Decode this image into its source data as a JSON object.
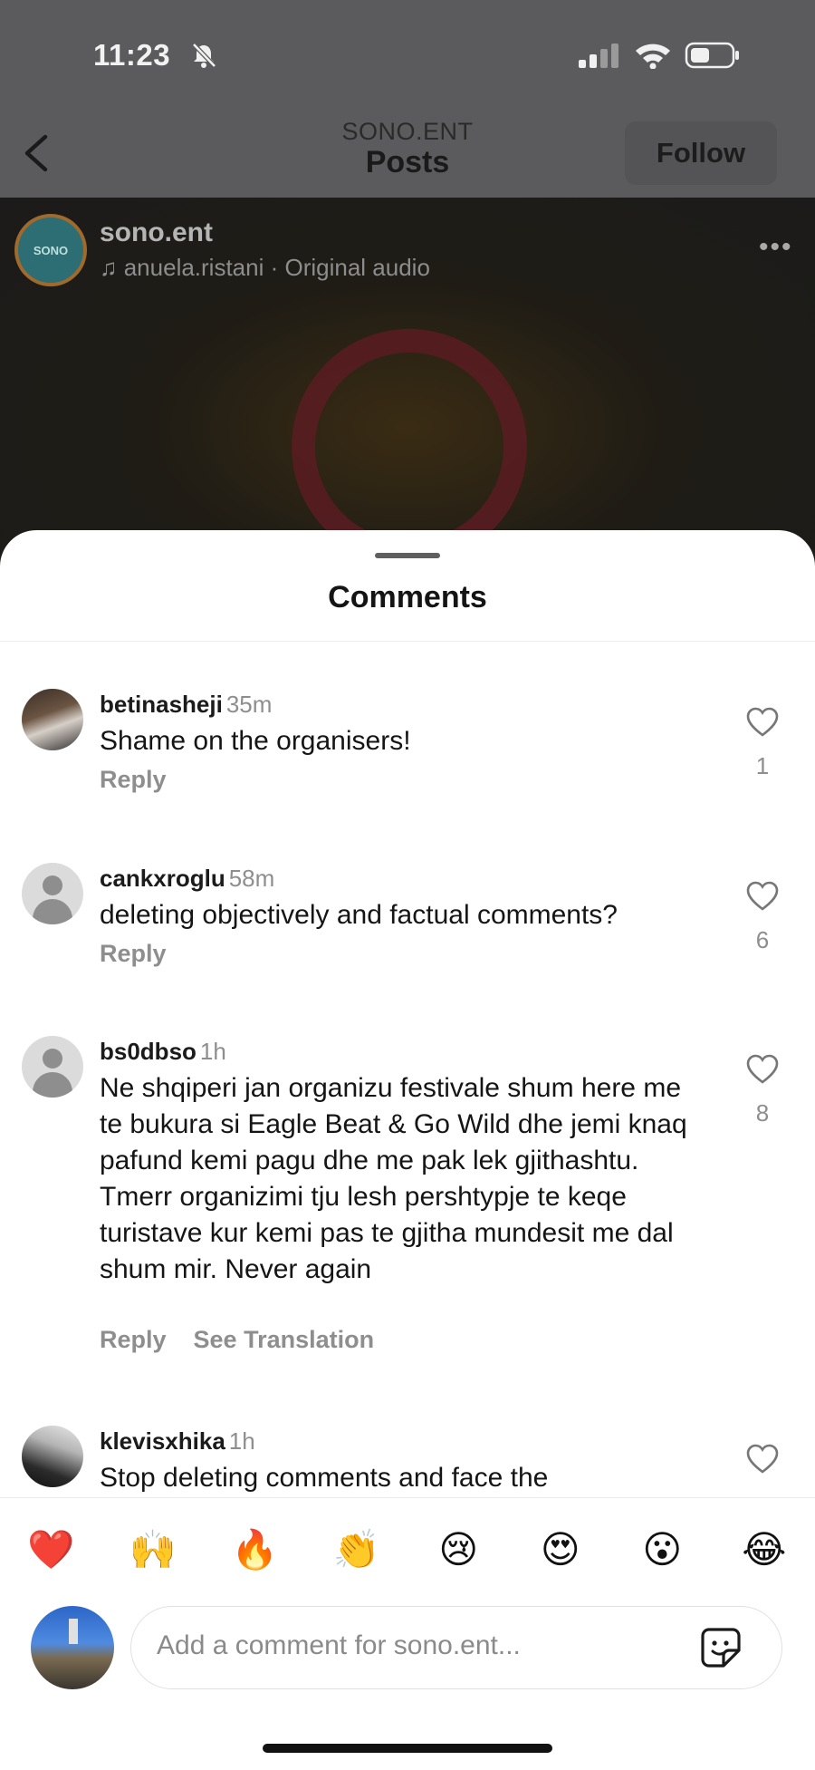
{
  "status_bar": {
    "time": "11:23"
  },
  "header": {
    "subtitle": "SONO.ENT",
    "title": "Posts",
    "follow_label": "Follow"
  },
  "post": {
    "avatar_text": "SONO",
    "username": "sono.ent",
    "audio": "♫ anuela.ristani · Original audio",
    "more": "•••"
  },
  "sheet": {
    "title": "Comments"
  },
  "comments": [
    {
      "user": "betinasheji",
      "time": "35m",
      "text": "Shame on the organisers!",
      "reply": "Reply",
      "likes": "1"
    },
    {
      "user": "cankxroglu",
      "time": "58m",
      "text": "deleting objectively and factual comments?",
      "reply": "Reply",
      "likes": "6"
    },
    {
      "user": "bs0dbso",
      "time": "1h",
      "text": "Ne shqiperi jan organizu festivale shum here me te bukura si Eagle Beat & Go Wild dhe jemi knaq pafund kemi pagu dhe me pak lek gjithashtu. Tmerr organizimi tju lesh pershtypje te keqe turistave kur kemi pas te gjitha  mundesit me dal shum mir. Never again",
      "reply": "Reply",
      "translate": "See Translation",
      "likes": "8"
    },
    {
      "user": "klevisxhika",
      "time": "1h",
      "text": "Stop deleting comments and face the"
    }
  ],
  "emoji_bar": [
    "❤️",
    "🙌",
    "🔥",
    "👏",
    "😢",
    "😍",
    "😮",
    "😂"
  ],
  "input": {
    "placeholder": "Add a comment for sono.ent..."
  }
}
